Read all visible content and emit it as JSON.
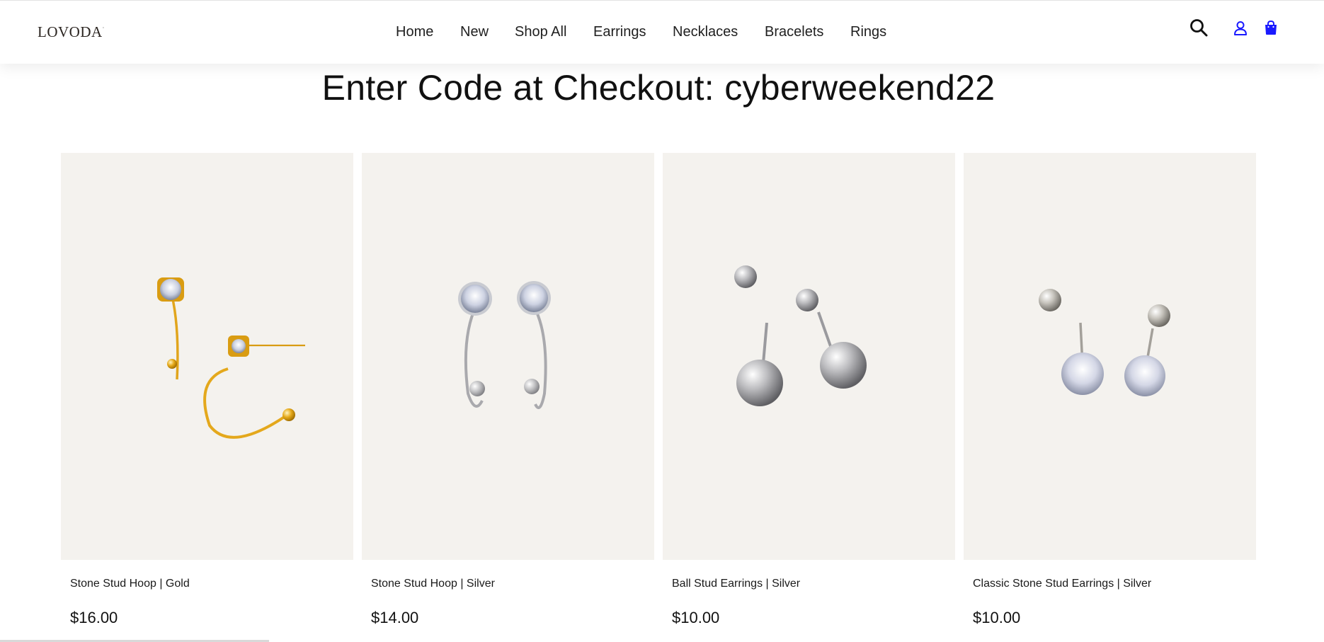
{
  "header": {
    "logo": "LOVODA",
    "logo_mark": "·",
    "nav": [
      {
        "label": "Home"
      },
      {
        "label": "New"
      },
      {
        "label": "Shop All"
      },
      {
        "label": "Earrings"
      },
      {
        "label": "Necklaces"
      },
      {
        "label": "Bracelets"
      },
      {
        "label": "Rings"
      }
    ],
    "icons": {
      "search": "search-icon",
      "account": "account-icon",
      "cart": "cart-icon"
    },
    "colors": {
      "account_icon": "#1a1aff",
      "cart_icon": "#1a1aff",
      "search_icon": "#111111"
    }
  },
  "promo": {
    "text": "Enter Code at Checkout: cyberweekend22"
  },
  "products": [
    {
      "name": "Stone Stud Hoop | Gold",
      "price": "$16.00",
      "metal": "gold"
    },
    {
      "name": "Stone Stud Hoop | Silver",
      "price": "$14.00",
      "metal": "silver"
    },
    {
      "name": "Ball Stud Earrings | Silver",
      "price": "$10.00",
      "metal": "silver"
    },
    {
      "name": "Classic Stone Stud Earrings | Silver",
      "price": "$10.00",
      "metal": "silver"
    }
  ]
}
